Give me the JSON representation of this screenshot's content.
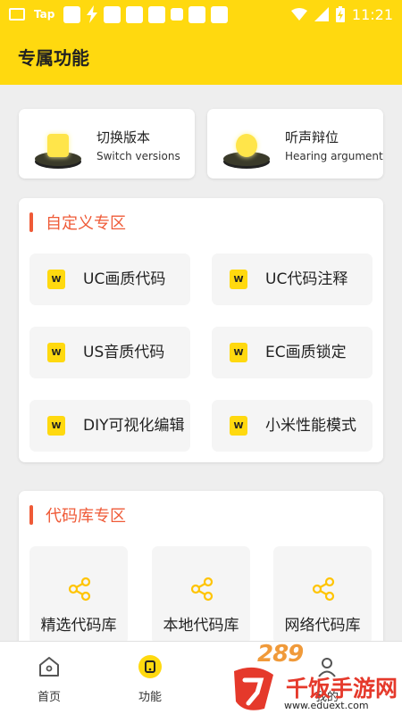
{
  "status_bar": {
    "tap_label": "Tap",
    "time": "11:21"
  },
  "header": {
    "title": "专属功能"
  },
  "switch_cards": [
    {
      "title": "切换版本",
      "subtitle": "Switch versions"
    },
    {
      "title": "听声辩位",
      "subtitle": "Hearing argument"
    }
  ],
  "custom_section": {
    "title": "自定义专区",
    "items": [
      {
        "label": "UC画质代码",
        "icon": "w-icon"
      },
      {
        "label": "UC代码注释",
        "icon": "w-icon"
      },
      {
        "label": "US音质代码",
        "icon": "w-icon"
      },
      {
        "label": "EC画质锁定",
        "icon": "w-icon"
      },
      {
        "label": "DIY可视化编辑",
        "icon": "w-icon"
      },
      {
        "label": "小米性能模式",
        "icon": "w-icon"
      }
    ]
  },
  "library_section": {
    "title": "代码库专区",
    "items": [
      {
        "label": "精选代码库",
        "icon": "share-icon"
      },
      {
        "label": "本地代码库",
        "icon": "share-icon"
      },
      {
        "label": "网络代码库",
        "icon": "share-icon"
      }
    ]
  },
  "bottom_nav": {
    "items": [
      {
        "label": "首页",
        "icon": "home-icon"
      },
      {
        "label": "功能",
        "icon": "function-icon"
      },
      {
        "label": "我的",
        "icon": "profile-icon"
      }
    ]
  },
  "watermark": {
    "number": "289",
    "text": "千饭手游网",
    "url": "www.eduext.com"
  },
  "colors": {
    "brand_yellow": "#ffd90f",
    "accent_orange": "#ef5a37",
    "background": "#eeeeee"
  }
}
